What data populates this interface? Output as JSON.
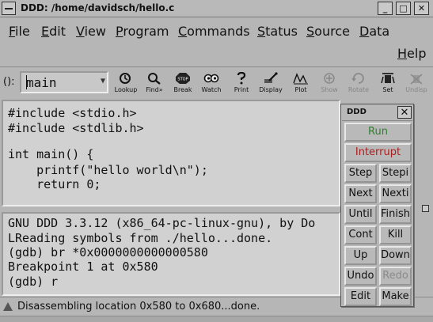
{
  "window": {
    "title": "DDD: /home/davidsch/hello.c",
    "buttons": [
      "_",
      "□",
      "✕"
    ]
  },
  "menubar": {
    "items": [
      {
        "label": "File",
        "key": "F",
        "rest": "ile"
      },
      {
        "label": "Edit",
        "key": "E",
        "rest": "dit"
      },
      {
        "label": "View",
        "key": "V",
        "rest": "iew"
      },
      {
        "label": "Program",
        "key": "P",
        "rest": "rogram"
      },
      {
        "label": "Commands",
        "key": "C",
        "rest": "ommands"
      },
      {
        "label": "Status",
        "key": "S",
        "rest": "tatus"
      },
      {
        "label": "Source",
        "key": "S",
        "rest": "ource"
      },
      {
        "label": "Data",
        "key": "D",
        "rest": "ata"
      }
    ],
    "help": {
      "label": "Help",
      "key": "H",
      "rest": "elp"
    }
  },
  "toolbar": {
    "arg_label": "():",
    "arg_value": "main",
    "tools": [
      {
        "label": "Lookup",
        "icon": "lookup-icon",
        "enabled": true
      },
      {
        "label": "Find»",
        "icon": "find-icon",
        "enabled": true
      },
      {
        "label": "Break",
        "icon": "stop-icon",
        "enabled": true
      },
      {
        "label": "Watch",
        "icon": "watch-icon",
        "enabled": true
      },
      {
        "label": "Print",
        "icon": "print-icon",
        "enabled": true
      },
      {
        "label": "Display",
        "icon": "display-icon",
        "enabled": true
      },
      {
        "label": "Plot",
        "icon": "plot-icon",
        "enabled": true
      },
      {
        "label": "Show",
        "icon": "show-icon",
        "enabled": false
      },
      {
        "label": "Rotate",
        "icon": "rotate-icon",
        "enabled": false
      },
      {
        "label": "Set",
        "icon": "set-icon",
        "enabled": true
      },
      {
        "label": "Undisp",
        "icon": "undisp-icon",
        "enabled": false
      }
    ]
  },
  "source": {
    "lines": [
      "#include <stdio.h>",
      "#include <stdlib.h>",
      "",
      "int main() {",
      "    printf(\"hello world\\n\");",
      "    return 0;"
    ]
  },
  "console": {
    "lines": [
      "GNU DDD 3.3.12 (x86_64-pc-linux-gnu), by Do",
      "LReading symbols from ./hello...done.",
      "(gdb) br *0x0000000000000580",
      "Breakpoint 1 at 0x580",
      "(gdb) r"
    ]
  },
  "status": {
    "text": "Disassembling location 0x580 to 0x680...done."
  },
  "command_tool": {
    "title": "DDD",
    "close": "✕",
    "run": "Run",
    "interrupt": "Interrupt",
    "grid": [
      [
        "Step",
        "Stepi"
      ],
      [
        "Next",
        "Nexti"
      ],
      [
        "Until",
        "Finish"
      ],
      [
        "Cont",
        "Kill"
      ],
      [
        "Up",
        "Down"
      ],
      [
        "Undo",
        "Redo"
      ],
      [
        "Edit",
        "Make"
      ]
    ],
    "colors": {
      "run": "#2f7f2f",
      "interrupt": "#a82020",
      "disabled": "#8a8a8a"
    }
  }
}
